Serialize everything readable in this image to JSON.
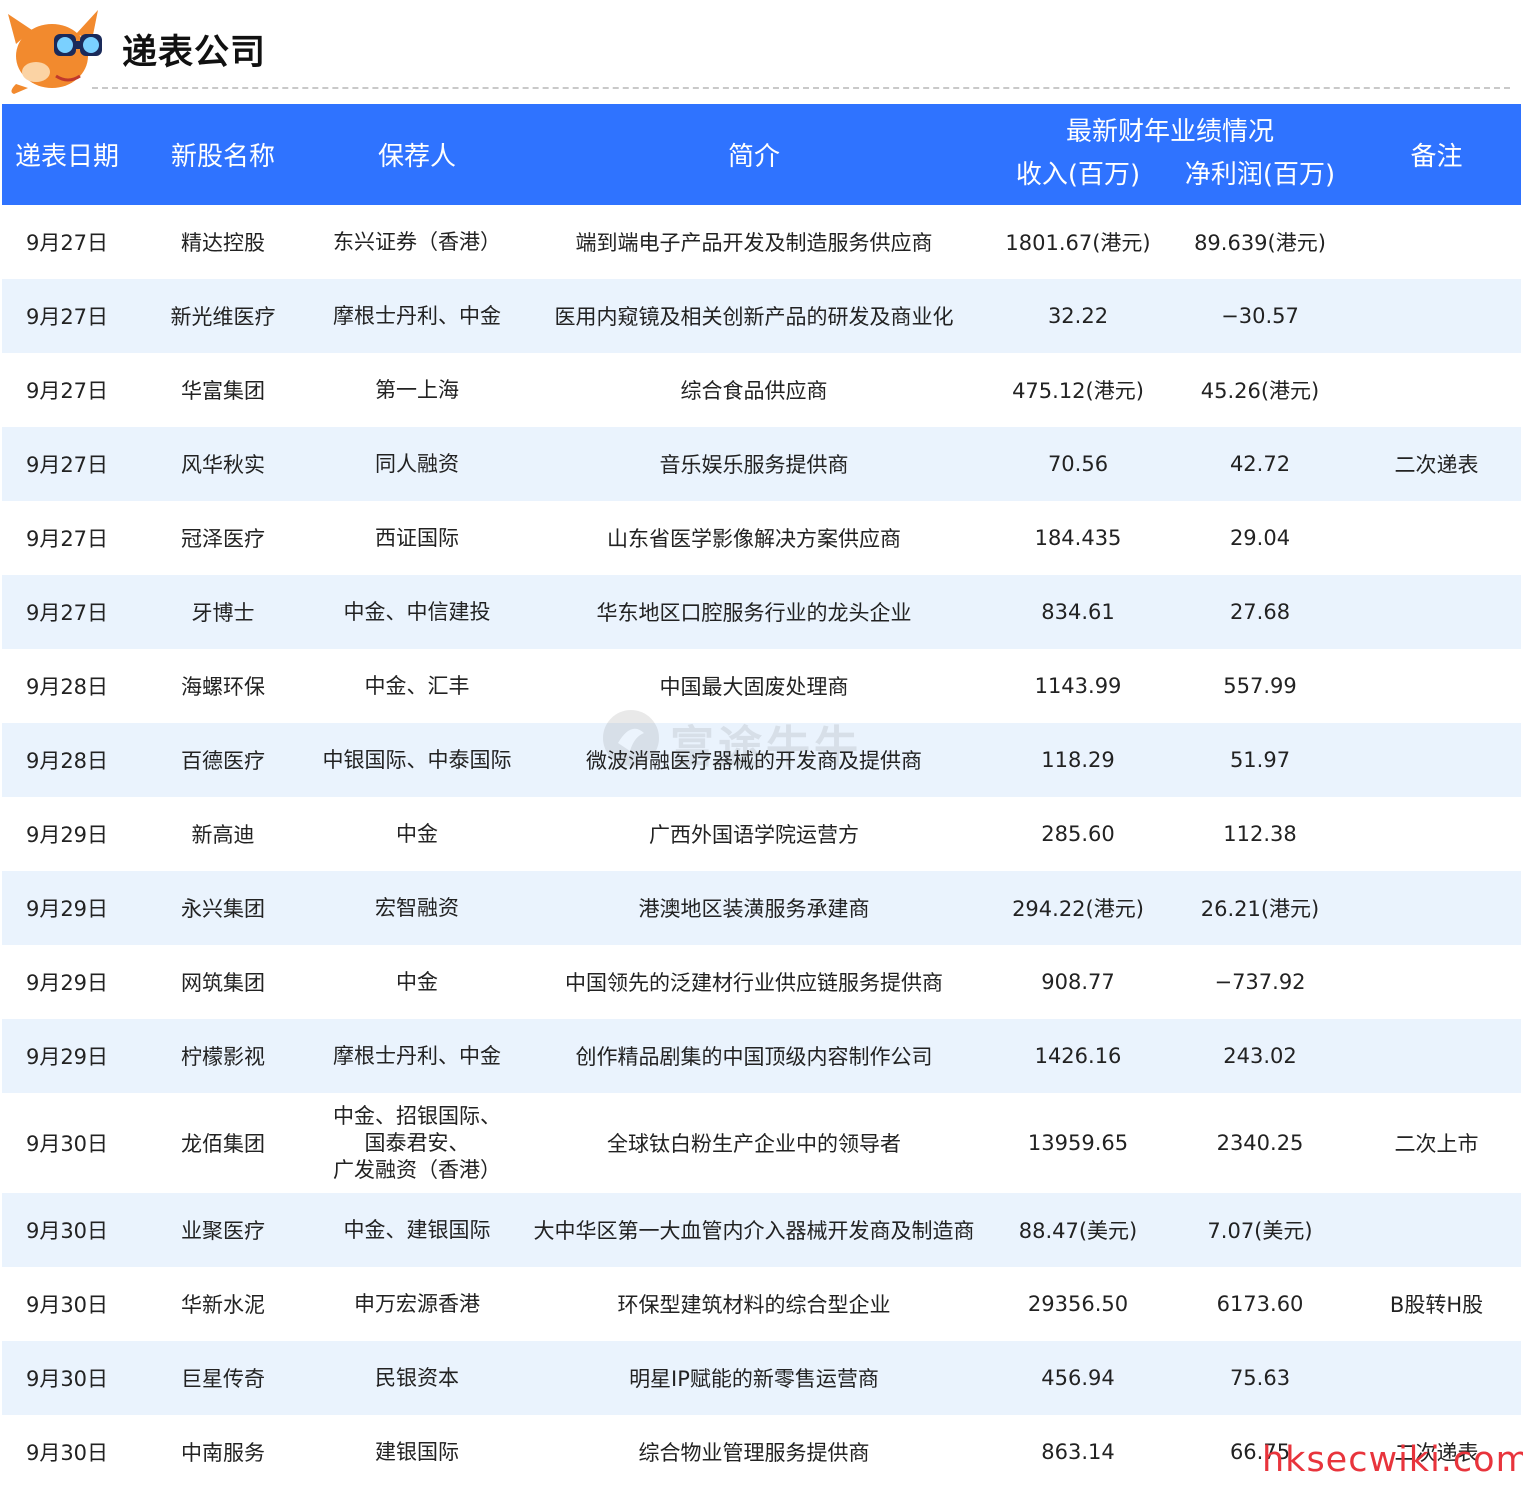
{
  "page": {
    "title": "递表公司"
  },
  "table": {
    "headers": {
      "date": "递表日期",
      "name": "新股名称",
      "sponsor": "保荐人",
      "intro": "简介",
      "performance_group": "最新财年业绩情况",
      "revenue": "收入(百万)",
      "profit": "净利润(百万)",
      "note": "备注"
    },
    "rows": [
      {
        "date": "9月27日",
        "name": "精达控股",
        "sponsor": [
          "东兴证券（香港）"
        ],
        "intro": "端到端电子产品开发及制造服务供应商",
        "revenue": "1801.67(港元)",
        "profit": "89.639(港元)",
        "note": ""
      },
      {
        "date": "9月27日",
        "name": "新光维医疗",
        "sponsor": [
          "摩根士丹利、中金"
        ],
        "intro": "医用内窥镜及相关创新产品的研发及商业化",
        "revenue": "32.22",
        "profit": "−30.57",
        "note": ""
      },
      {
        "date": "9月27日",
        "name": "华富集团",
        "sponsor": [
          "第一上海"
        ],
        "intro": "综合食品供应商",
        "revenue": "475.12(港元)",
        "profit": "45.26(港元)",
        "note": ""
      },
      {
        "date": "9月27日",
        "name": "风华秋实",
        "sponsor": [
          "同人融资"
        ],
        "intro": "音乐娱乐服务提供商",
        "revenue": "70.56",
        "profit": "42.72",
        "note": "二次递表"
      },
      {
        "date": "9月27日",
        "name": "冠泽医疗",
        "sponsor": [
          "西证国际"
        ],
        "intro": "山东省医学影像解决方案供应商",
        "revenue": "184.435",
        "profit": "29.04",
        "note": ""
      },
      {
        "date": "9月27日",
        "name": "牙博士",
        "sponsor": [
          "中金、中信建投"
        ],
        "intro": "华东地区口腔服务行业的龙头企业",
        "revenue": "834.61",
        "profit": "27.68",
        "note": ""
      },
      {
        "date": "9月28日",
        "name": "海螺环保",
        "sponsor": [
          "中金、汇丰"
        ],
        "intro": "中国最大固废处理商",
        "revenue": "1143.99",
        "profit": "557.99",
        "note": ""
      },
      {
        "date": "9月28日",
        "name": "百德医疗",
        "sponsor": [
          "中银国际、中泰国际"
        ],
        "intro": "微波消融医疗器械的开发商及提供商",
        "revenue": "118.29",
        "profit": "51.97",
        "note": ""
      },
      {
        "date": "9月29日",
        "name": "新高迪",
        "sponsor": [
          "中金"
        ],
        "intro": "广西外国语学院运营方",
        "revenue": "285.60",
        "profit": "112.38",
        "note": ""
      },
      {
        "date": "9月29日",
        "name": "永兴集团",
        "sponsor": [
          "宏智融资"
        ],
        "intro": "港澳地区装潢服务承建商",
        "revenue": "294.22(港元)",
        "profit": "26.21(港元)",
        "note": ""
      },
      {
        "date": "9月29日",
        "name": "网筑集团",
        "sponsor": [
          "中金"
        ],
        "intro": "中国领先的泛建材行业供应链服务提供商",
        "revenue": "908.77",
        "profit": "−737.92",
        "note": ""
      },
      {
        "date": "9月29日",
        "name": "柠檬影视",
        "sponsor": [
          "摩根士丹利、中金"
        ],
        "intro": "创作精品剧集的中国顶级内容制作公司",
        "revenue": "1426.16",
        "profit": "243.02",
        "note": ""
      },
      {
        "date": "9月30日",
        "name": "龙佰集团",
        "sponsor": [
          "中金、招银国际、",
          "国泰君安、",
          "广发融资（香港）"
        ],
        "intro": "全球钛白粉生产企业中的领导者",
        "revenue": "13959.65",
        "profit": "2340.25",
        "note": "二次上市"
      },
      {
        "date": "9月30日",
        "name": "业聚医疗",
        "sponsor": [
          "中金、建银国际"
        ],
        "intro": "大中华区第一大血管内介入器械开发商及制造商",
        "revenue": "88.47(美元)",
        "profit": "7.07(美元)",
        "note": ""
      },
      {
        "date": "9月30日",
        "name": "华新水泥",
        "sponsor": [
          "申万宏源香港"
        ],
        "intro": "环保型建筑材料的综合型企业",
        "revenue": "29356.50",
        "profit": "6173.60",
        "note": "B股转H股"
      },
      {
        "date": "9月30日",
        "name": "巨星传奇",
        "sponsor": [
          "民银资本"
        ],
        "intro": "明星IP赋能的新零售运营商",
        "revenue": "456.94",
        "profit": "75.63",
        "note": ""
      },
      {
        "date": "9月30日",
        "name": "中南服务",
        "sponsor": [
          "建银国际"
        ],
        "intro": "综合物业管理服务提供商",
        "revenue": "863.14",
        "profit": "66.75",
        "note": "二次递表"
      }
    ]
  },
  "watermark": {
    "text": "富途牛牛",
    "icon": "futu-logo-icon"
  },
  "site_mark": "hksecwiki.com",
  "colors": {
    "header_bg": "#2f73ff",
    "stripe": "#eaf3fd",
    "mascot": "#f28a2e",
    "site_mark": "#e8343c"
  }
}
